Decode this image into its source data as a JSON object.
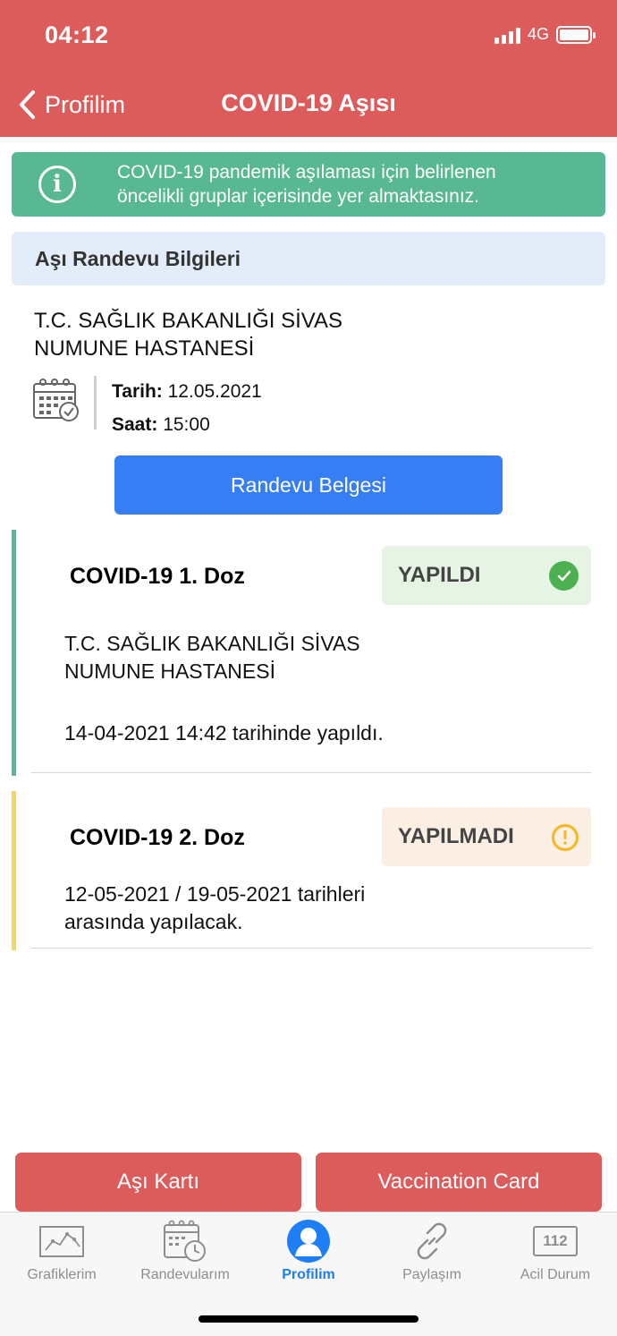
{
  "status_bar": {
    "time": "04:12",
    "network": "4G"
  },
  "nav": {
    "back_label": "Profilim",
    "title": "COVID-19 Aşısı"
  },
  "banner": {
    "icon": "info-icon",
    "line1": "COVID-19 pandemik aşılaması için belirlenen",
    "line2": "öncelikli gruplar içerisinde yer almaktasınız."
  },
  "appointment": {
    "section_title": "Aşı Randevu Bilgileri",
    "hospital_line1": "T.C. SAĞLIK BAKANLIĞI SİVAS",
    "hospital_line2": "NUMUNE HASTANESİ",
    "date_label": "Tarih:",
    "date_value": "12.05.2021",
    "time_label": "Saat:",
    "time_value": "15:00",
    "document_button": "Randevu Belgesi"
  },
  "doses": [
    {
      "title": "COVID-19 1. Doz",
      "status": "YAPILDI",
      "status_icon": "check-circle-icon",
      "accent": "#57b893",
      "badge_bg": "#e6f5e3",
      "icon_color": "#4cb050",
      "hospital_line1": "T.C. SAĞLIK BAKANLIĞI SİVAS",
      "hospital_line2": "NUMUNE HASTANESİ",
      "note": "14-04-2021 14:42 tarihinde yapıldı."
    },
    {
      "title": "COVID-19 2. Doz",
      "status": "YAPILMADI",
      "status_icon": "warning-circle-icon",
      "accent": "#f3d667",
      "badge_bg": "#fbefe4",
      "icon_color": "#f3b820",
      "note_line1": "12-05-2021 / 19-05-2021 tarihleri",
      "note_line2": "arasında yapılacak."
    }
  ],
  "buttons": {
    "asi_karti": "Aşı Kartı",
    "vaccination_card": "Vaccination Card"
  },
  "tabs": [
    {
      "label": "Grafiklerim",
      "icon": "chart-icon",
      "active": false
    },
    {
      "label": "Randevularım",
      "icon": "calendar-clock-icon",
      "active": false
    },
    {
      "label": "Profilim",
      "icon": "user-icon",
      "active": true
    },
    {
      "label": "Paylaşım",
      "icon": "link-icon",
      "active": false
    },
    {
      "label": "Acil Durum",
      "icon": "emergency-112-icon",
      "active": false,
      "icon_text": "112"
    }
  ],
  "colors": {
    "header": "#dc5b5b",
    "primary_blue": "#367ef3",
    "active_tab": "#1d7ef5"
  }
}
